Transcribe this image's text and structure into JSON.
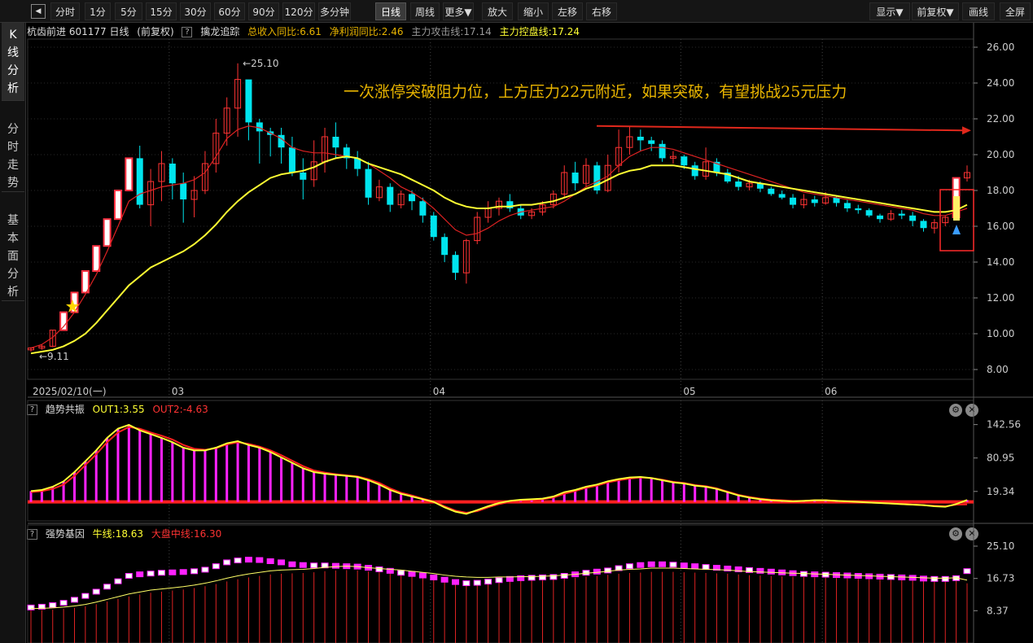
{
  "toolbar": {
    "periods": [
      "分时",
      "1分",
      "5分",
      "15分",
      "30分",
      "60分",
      "90分",
      "120分",
      "多分钟",
      "日线",
      "周线",
      "更多▼",
      "放大",
      "缩小",
      "左移",
      "右移"
    ],
    "active_period": "日线",
    "right": [
      "显示▼",
      "前复权▼",
      "画线",
      "全屏"
    ]
  },
  "sidebar": {
    "tabs": [
      {
        "label": "K线分析",
        "active": true
      },
      {
        "label": "分时走势",
        "active": false
      },
      {
        "label": "基本面分析",
        "active": false
      }
    ]
  },
  "stock": {
    "header": "杭齿前进 601177 日线",
    "adjust": "(前复权)",
    "indicator_name": "擒龙追踪",
    "revenue_yoy": "总收入同比:6.61",
    "profit_yoy": "净利润同比:2.46",
    "attack_line": "主力攻击线:17.14",
    "control_line": "主力控盘线:17.24"
  },
  "annotation": {
    "text": "一次涨停突破阻力位，上方压力22元附近，如果突破，有望挑战25元压力",
    "high_label": "25.10",
    "low_label": "9.11"
  },
  "dates": {
    "start": "2025/02/10(一)",
    "months": [
      "03",
      "04",
      "05",
      "06"
    ]
  },
  "panel2": {
    "name": "趋势共振",
    "out1": "OUT1:3.55",
    "out2": "OUT2:-4.63"
  },
  "panel3": {
    "name": "强势基因",
    "niu": "牛线:18.63",
    "dapan": "大盘中线:16.30"
  },
  "colors": {
    "up": "#ff3333",
    "down": "#00e5ee",
    "ma_yellow": "#ffff33",
    "ma_red": "#dd2222",
    "annotation": "#e8b400",
    "magenta": "#ff22ff",
    "limit_up": "#ff3344"
  },
  "chart_data": [
    {
      "type": "candlestick",
      "title": "杭齿前进 601177 日线",
      "y_ticks": [
        "26.00",
        "24.00",
        "22.00",
        "20.00",
        "18.00",
        "16.00",
        "14.00",
        "12.00",
        "10.00",
        "8.00"
      ],
      "ylim": [
        8,
        26
      ],
      "x_ticks": [
        "2025/02/10(一)",
        "03",
        "04",
        "05",
        "06"
      ],
      "candles": [
        [
          9.1,
          9.2,
          9.0,
          9.25
        ],
        [
          9.2,
          9.3,
          9.1,
          9.4
        ],
        [
          9.3,
          10.2,
          9.25,
          10.2
        ],
        [
          10.2,
          11.2,
          10.2,
          11.2
        ],
        [
          11.2,
          12.3,
          11.2,
          12.3
        ],
        [
          12.3,
          13.5,
          12.3,
          13.5
        ],
        [
          13.5,
          14.9,
          13.5,
          14.9
        ],
        [
          14.9,
          16.4,
          14.9,
          16.4
        ],
        [
          16.4,
          18.0,
          16.4,
          18.0
        ],
        [
          18.0,
          19.8,
          18.0,
          19.8
        ],
        [
          19.8,
          17.2,
          17.0,
          20.5
        ],
        [
          17.2,
          18.5,
          16.0,
          19.2
        ],
        [
          18.5,
          19.5,
          17.4,
          20.2
        ],
        [
          19.5,
          18.4,
          17.5,
          19.8
        ],
        [
          18.4,
          17.5,
          16.2,
          19.0
        ],
        [
          17.5,
          18.0,
          16.5,
          18.8
        ],
        [
          18.0,
          19.5,
          17.8,
          20.2
        ],
        [
          19.5,
          21.2,
          19.0,
          22.0
        ],
        [
          21.2,
          22.6,
          20.5,
          23.2
        ],
        [
          22.6,
          24.2,
          21.0,
          25.1
        ],
        [
          24.2,
          21.8,
          20.8,
          23.4
        ],
        [
          21.8,
          21.3,
          19.5,
          22.0
        ],
        [
          21.3,
          21.1,
          19.9,
          21.5
        ],
        [
          21.1,
          20.4,
          19.5,
          21.5
        ],
        [
          20.4,
          19.0,
          18.8,
          21.0
        ],
        [
          19.0,
          18.6,
          17.5,
          19.8
        ],
        [
          18.6,
          19.6,
          18.2,
          20.8
        ],
        [
          19.6,
          21.0,
          19.0,
          21.5
        ],
        [
          21.0,
          20.4,
          19.8,
          21.8
        ],
        [
          20.4,
          19.8,
          19.2,
          20.6
        ],
        [
          19.8,
          19.2,
          18.8,
          20.2
        ],
        [
          19.2,
          17.6,
          17.2,
          19.6
        ],
        [
          17.6,
          18.2,
          17.4,
          18.6
        ],
        [
          18.2,
          17.2,
          16.8,
          18.4
        ],
        [
          17.2,
          17.8,
          17.0,
          18.0
        ],
        [
          17.8,
          17.4,
          16.9,
          18.0
        ],
        [
          17.4,
          16.6,
          16.2,
          17.6
        ],
        [
          16.6,
          15.4,
          15.2,
          16.8
        ],
        [
          15.4,
          14.4,
          14.0,
          15.6
        ],
        [
          14.4,
          13.4,
          13.0,
          14.6
        ],
        [
          13.4,
          15.2,
          12.8,
          15.3
        ],
        [
          15.2,
          16.5,
          15.0,
          16.8
        ],
        [
          16.5,
          17.0,
          16.2,
          17.4
        ],
        [
          17.0,
          17.4,
          16.6,
          17.6
        ],
        [
          17.4,
          17.0,
          16.8,
          17.8
        ],
        [
          17.0,
          16.6,
          16.4,
          17.2
        ],
        [
          16.6,
          16.8,
          16.4,
          17.0
        ],
        [
          16.8,
          17.2,
          16.6,
          17.4
        ],
        [
          17.2,
          17.8,
          17.0,
          18.0
        ],
        [
          17.8,
          19.0,
          17.6,
          19.4
        ],
        [
          19.0,
          18.4,
          18.0,
          19.6
        ],
        [
          18.4,
          19.4,
          18.2,
          19.8
        ],
        [
          19.4,
          18.0,
          17.8,
          19.6
        ],
        [
          18.0,
          19.4,
          17.9,
          20.0
        ],
        [
          19.4,
          20.4,
          19.0,
          21.4
        ],
        [
          20.4,
          21.0,
          20.0,
          21.6
        ],
        [
          21.0,
          20.8,
          20.2,
          21.4
        ],
        [
          20.8,
          20.6,
          20.2,
          21.0
        ],
        [
          20.6,
          19.8,
          19.6,
          20.8
        ],
        [
          19.8,
          19.9,
          19.5,
          20.2
        ],
        [
          19.9,
          19.4,
          19.2,
          20.0
        ],
        [
          19.4,
          18.8,
          18.6,
          19.6
        ],
        [
          18.8,
          19.6,
          18.6,
          20.4
        ],
        [
          19.6,
          19.0,
          18.8,
          19.8
        ],
        [
          19.0,
          18.5,
          18.4,
          19.2
        ],
        [
          18.5,
          18.2,
          18.0,
          18.8
        ],
        [
          18.2,
          18.4,
          18.0,
          18.6
        ],
        [
          18.4,
          18.1,
          17.9,
          18.5
        ],
        [
          18.1,
          17.8,
          17.7,
          18.2
        ],
        [
          17.8,
          17.6,
          17.5,
          18.0
        ],
        [
          17.6,
          17.2,
          17.0,
          17.8
        ],
        [
          17.2,
          17.5,
          17.0,
          17.8
        ],
        [
          17.5,
          17.3,
          17.1,
          17.7
        ],
        [
          17.3,
          17.6,
          17.2,
          17.9
        ],
        [
          17.6,
          17.3,
          17.1,
          17.7
        ],
        [
          17.3,
          17.0,
          16.8,
          17.5
        ],
        [
          17.0,
          16.9,
          16.7,
          17.2
        ],
        [
          16.9,
          16.6,
          16.5,
          17.0
        ],
        [
          16.6,
          16.4,
          16.2,
          16.7
        ],
        [
          16.4,
          16.7,
          16.3,
          16.9
        ],
        [
          16.7,
          16.6,
          16.4,
          16.9
        ],
        [
          16.6,
          16.3,
          16.0,
          16.8
        ],
        [
          16.3,
          15.9,
          15.7,
          16.4
        ],
        [
          15.9,
          16.2,
          15.6,
          16.4
        ],
        [
          16.2,
          16.5,
          16.0,
          16.6
        ],
        [
          16.5,
          18.7,
          16.5,
          18.7
        ],
        [
          18.7,
          19.0,
          18.5,
          19.4
        ]
      ],
      "ma_red": [
        9.2,
        9.4,
        9.8,
        10.4,
        11.2,
        12.2,
        13.3,
        14.6,
        16.0,
        17.4,
        17.8,
        18.0,
        18.2,
        18.3,
        18.4,
        18.6,
        19.0,
        19.9,
        20.9,
        21.4,
        21.6,
        21.5,
        21.2,
        20.9,
        20.4,
        20.2,
        20.1,
        20.1,
        20.0,
        19.9,
        19.8,
        19.5,
        19.1,
        18.7,
        18.2,
        17.9,
        17.5,
        17.0,
        16.4,
        15.8,
        15.5,
        15.6,
        15.9,
        16.3,
        16.6,
        16.8,
        16.9,
        17.0,
        17.1,
        17.4,
        17.8,
        18.2,
        18.5,
        18.8,
        19.4,
        19.9,
        20.2,
        20.4,
        20.4,
        20.3,
        20.1,
        19.9,
        19.7,
        19.5,
        19.3,
        19.1,
        18.9,
        18.7,
        18.5,
        18.3,
        18.1,
        17.9,
        17.8,
        17.7,
        17.6,
        17.5,
        17.4,
        17.3,
        17.2,
        17.1,
        17.0,
        16.9,
        16.7,
        16.6,
        16.6,
        16.8,
        17.0
      ],
      "ma_yellow": [
        8.9,
        9.0,
        9.1,
        9.3,
        9.6,
        10.0,
        10.6,
        11.3,
        12.0,
        12.7,
        13.2,
        13.7,
        14.0,
        14.3,
        14.6,
        15.0,
        15.5,
        16.1,
        16.8,
        17.4,
        17.9,
        18.3,
        18.7,
        18.9,
        19.0,
        19.1,
        19.3,
        19.6,
        19.8,
        19.9,
        19.8,
        19.5,
        19.3,
        19.1,
        18.9,
        18.6,
        18.3,
        18.0,
        17.6,
        17.3,
        17.1,
        17.0,
        17.0,
        17.1,
        17.1,
        17.2,
        17.2,
        17.3,
        17.4,
        17.6,
        17.8,
        18.1,
        18.3,
        18.6,
        18.9,
        19.1,
        19.2,
        19.4,
        19.4,
        19.4,
        19.3,
        19.2,
        19.1,
        19.0,
        18.9,
        18.7,
        18.5,
        18.4,
        18.3,
        18.2,
        18.1,
        18.0,
        17.9,
        17.8,
        17.7,
        17.6,
        17.5,
        17.4,
        17.3,
        17.2,
        17.1,
        17.0,
        16.9,
        16.8,
        16.8,
        16.9,
        17.2
      ]
    },
    {
      "type": "bar",
      "title": "趋势共振",
      "y_ticks": [
        "142.56",
        "80.95",
        "19.34"
      ],
      "ylim": [
        -35,
        160
      ],
      "out1": [
        20,
        22,
        28,
        38,
        55,
        75,
        95,
        118,
        135,
        142,
        132,
        125,
        118,
        110,
        100,
        95,
        95,
        100,
        108,
        112,
        105,
        100,
        92,
        82,
        72,
        62,
        55,
        52,
        50,
        48,
        46,
        40,
        32,
        22,
        15,
        10,
        5,
        0,
        -10,
        -18,
        -22,
        -15,
        -8,
        -2,
        2,
        4,
        5,
        6,
        10,
        18,
        22,
        28,
        32,
        38,
        42,
        45,
        46,
        44,
        40,
        36,
        34,
        30,
        28,
        24,
        18,
        12,
        8,
        5,
        3,
        2,
        1,
        2,
        3,
        3,
        2,
        1,
        0,
        -1,
        -2,
        -3,
        -4,
        -5,
        -6,
        -8,
        -9,
        -4,
        3.55
      ],
      "out2": [
        18,
        20,
        24,
        32,
        48,
        68,
        88,
        110,
        128,
        138,
        135,
        128,
        122,
        115,
        105,
        98,
        96,
        99,
        106,
        110,
        107,
        102,
        95,
        86,
        76,
        66,
        58,
        54,
        51,
        49,
        47,
        42,
        35,
        25,
        17,
        12,
        6,
        1,
        -8,
        -16,
        -20,
        -17,
        -10,
        -4,
        0,
        3,
        4,
        5,
        8,
        15,
        20,
        26,
        30,
        36,
        40,
        43,
        45,
        44,
        41,
        37,
        35,
        31,
        29,
        25,
        19,
        13,
        9,
        6,
        4,
        3,
        2,
        2,
        3,
        3,
        2,
        1,
        0,
        -1,
        -2,
        -3,
        -4,
        -5,
        -6,
        -7,
        -8,
        -5,
        -4.63
      ]
    },
    {
      "type": "bar",
      "title": "强势基因",
      "y_ticks": [
        "25.10",
        "16.73",
        "8.37"
      ],
      "ylim": [
        0,
        27
      ],
      "niu": [
        9.2,
        9.4,
        9.8,
        10.4,
        11.2,
        12.2,
        13.3,
        14.6,
        16.0,
        17.4,
        17.8,
        18.0,
        18.2,
        18.3,
        18.4,
        18.6,
        19.0,
        19.9,
        20.9,
        21.4,
        21.6,
        21.5,
        21.2,
        20.9,
        20.4,
        20.2,
        20.1,
        20.1,
        20.0,
        19.9,
        19.8,
        19.5,
        19.1,
        18.7,
        18.2,
        17.9,
        17.5,
        17.0,
        16.4,
        15.8,
        15.5,
        15.6,
        15.9,
        16.3,
        16.6,
        16.8,
        16.9,
        17.0,
        17.1,
        17.4,
        17.8,
        18.2,
        18.5,
        18.8,
        19.4,
        19.9,
        20.2,
        20.4,
        20.4,
        20.3,
        20.1,
        19.9,
        19.7,
        19.5,
        19.3,
        19.1,
        18.9,
        18.7,
        18.5,
        18.3,
        18.1,
        17.9,
        17.8,
        17.7,
        17.6,
        17.5,
        17.4,
        17.3,
        17.2,
        17.1,
        17.0,
        16.9,
        16.7,
        16.6,
        16.6,
        16.8,
        18.63
      ],
      "dapan": [
        8.9,
        9.0,
        9.1,
        9.3,
        9.6,
        10.0,
        10.6,
        11.3,
        12.0,
        12.7,
        13.2,
        13.7,
        14.0,
        14.3,
        14.6,
        15.0,
        15.5,
        16.1,
        16.8,
        17.4,
        17.9,
        18.3,
        18.7,
        18.9,
        19.0,
        19.1,
        19.3,
        19.6,
        19.8,
        19.9,
        19.8,
        19.5,
        19.3,
        19.1,
        18.9,
        18.6,
        18.3,
        18.0,
        17.6,
        17.3,
        17.1,
        17.0,
        17.0,
        17.1,
        17.1,
        17.2,
        17.2,
        17.3,
        17.4,
        17.6,
        17.8,
        18.1,
        18.3,
        18.6,
        18.9,
        19.1,
        19.2,
        19.4,
        19.4,
        19.4,
        19.3,
        19.2,
        19.1,
        19.0,
        18.9,
        18.7,
        18.5,
        18.4,
        18.3,
        18.2,
        18.1,
        18.0,
        17.9,
        17.8,
        17.7,
        17.6,
        17.5,
        17.4,
        17.3,
        17.2,
        17.1,
        17.0,
        16.9,
        16.8,
        16.8,
        16.9,
        16.3
      ]
    }
  ]
}
